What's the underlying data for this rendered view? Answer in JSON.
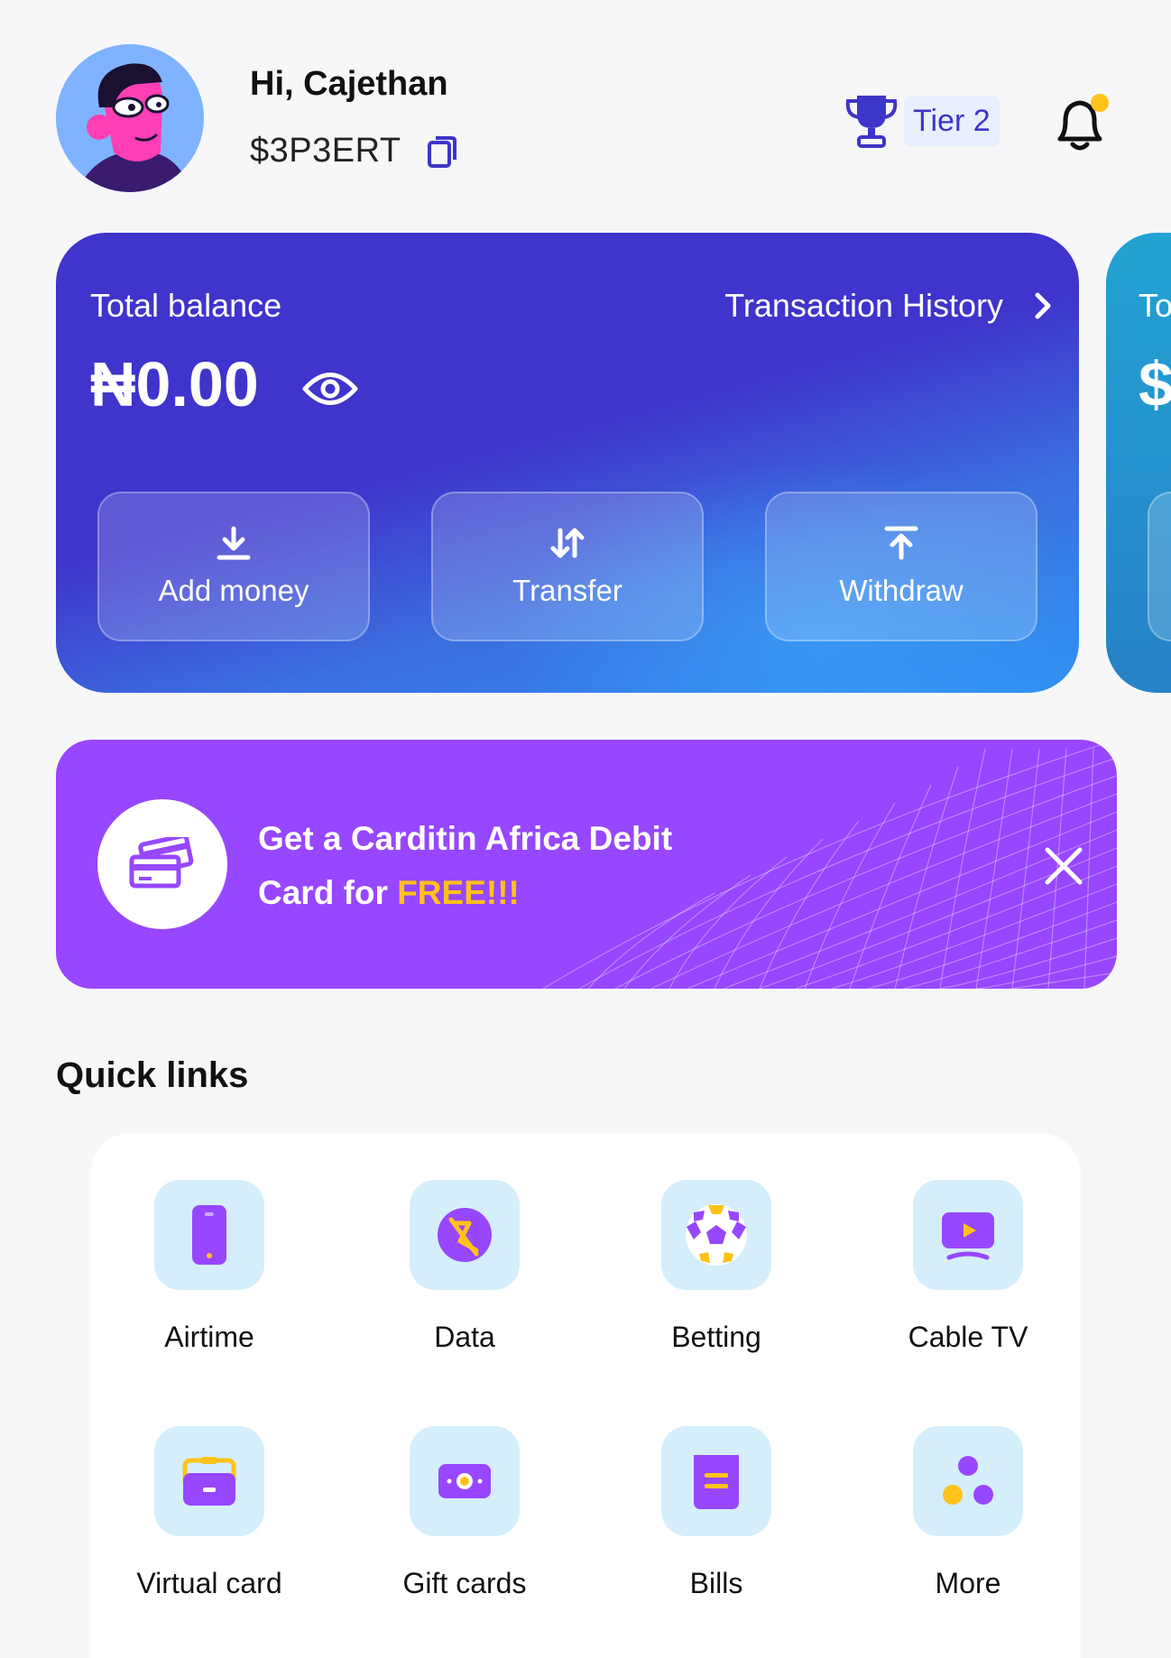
{
  "header": {
    "greeting": "Hi, Cajethan",
    "handle": "$3P3ERT",
    "tier_label": "Tier 2"
  },
  "balance_card": {
    "label": "Total balance",
    "amount": "₦0.00",
    "transaction_history_label": "Transaction History",
    "actions": [
      {
        "label": "Add money",
        "icon": "download-icon"
      },
      {
        "label": "Transfer",
        "icon": "transfer-arrows-icon"
      },
      {
        "label": "Withdraw",
        "icon": "upload-icon"
      }
    ]
  },
  "secondary_card": {
    "label_partial": "To",
    "amount_partial": "$"
  },
  "promo": {
    "text_line1": "Get a Carditin Africa Debit",
    "text_line2_prefix": "Card for ",
    "text_highlight": "FREE!!!"
  },
  "quick_links": {
    "title": "Quick links",
    "items": [
      {
        "label": "Airtime",
        "icon": "phone-icon"
      },
      {
        "label": "Data",
        "icon": "data-icon"
      },
      {
        "label": "Betting",
        "icon": "soccer-ball-icon"
      },
      {
        "label": "Cable TV",
        "icon": "tv-icon"
      },
      {
        "label": "Virtual card",
        "icon": "wallet-icon"
      },
      {
        "label": "Gift cards",
        "icon": "gift-card-icon"
      },
      {
        "label": "Bills",
        "icon": "bills-icon"
      },
      {
        "label": "More",
        "icon": "more-dots-icon"
      }
    ]
  },
  "colors": {
    "primary": "#3f34cb",
    "promo": "#9747ff",
    "accent_yellow": "#ffc21a",
    "tile_bg": "#d5eefc",
    "icon_purple": "#9747ff"
  }
}
